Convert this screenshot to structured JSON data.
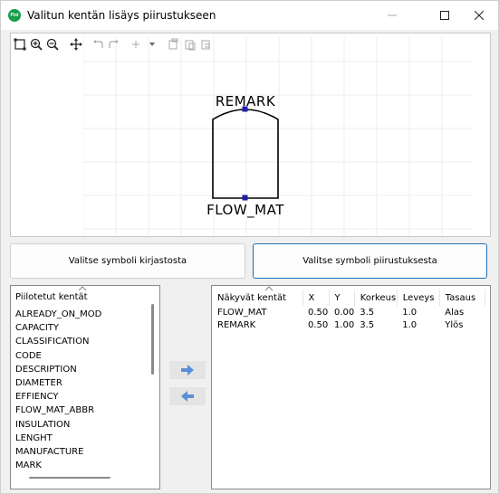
{
  "window": {
    "title": "Valitun kentän lisäys piirustukseen",
    "app_icon": "Pixl"
  },
  "toolbar": {
    "icons": [
      "zoom-extents-icon",
      "zoom-in-icon",
      "zoom-out-icon",
      "pan-icon",
      "undo-icon",
      "redo-icon",
      "move-icon",
      "dropdown-icon",
      "copy-icon",
      "paste-icon",
      "paste-special-icon"
    ]
  },
  "drawing": {
    "top_label": "REMARK",
    "bottom_label": "FLOW_MAT",
    "handle_color": "#1f1fa8"
  },
  "buttons": {
    "library": "Valitse symboli kirjastosta",
    "drawing": "Valitse symboli piirustuksesta"
  },
  "hidden_fields": {
    "header": "Piilotetut kentät",
    "items": [
      "ALREADY_ON_MOD",
      "CAPACITY",
      "CLASSIFICATION",
      "CODE",
      "DESCRIPTION",
      "DIAMETER",
      "EFFIENCY",
      "FLOW_MAT_ABBR",
      "INSULATION",
      "LENGHT",
      "MANUFACTURE",
      "MARK"
    ]
  },
  "visible_fields": {
    "columns": [
      "Näkyvät kentät",
      "X",
      "Y",
      "Korkeus",
      "Leveys",
      "Tasaus"
    ],
    "rows": [
      [
        "FLOW_MAT",
        "0.50",
        "0.00",
        "3.5",
        "1.0",
        "Alas"
      ],
      [
        "REMARK",
        "0.50",
        "1.00",
        "3.5",
        "1.0",
        "Ylös"
      ]
    ]
  },
  "colors": {
    "accent_border": "#1f6fb7",
    "arrow_blue": "#5b8fd6"
  }
}
